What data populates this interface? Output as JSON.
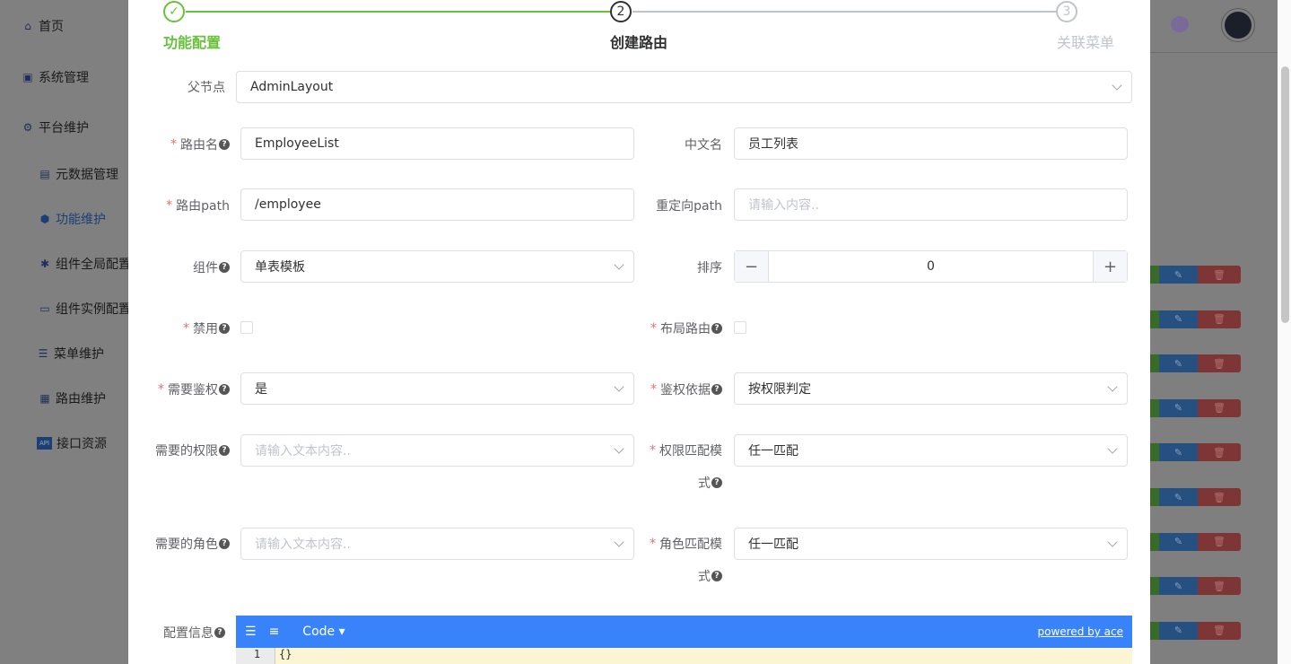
{
  "sidebar": {
    "items": [
      {
        "label": "首页",
        "icon": "home-icon"
      },
      {
        "label": "系统管理",
        "icon": "monitor-icon"
      },
      {
        "label": "平台维护",
        "icon": "gear-icon"
      },
      {
        "label": "元数据管理",
        "icon": "table-icon"
      },
      {
        "label": "功能维护",
        "icon": "cube-icon",
        "active": true
      },
      {
        "label": "组件全局配置",
        "icon": "puzzle-icon"
      },
      {
        "label": "组件实例配置",
        "icon": "window-icon"
      },
      {
        "label": "菜单维护",
        "icon": "list-icon"
      },
      {
        "label": "路由维护",
        "icon": "route-icon"
      },
      {
        "label": "接口资源",
        "icon": "api-icon"
      }
    ]
  },
  "steps": [
    {
      "num": "✓",
      "label": "功能配置",
      "status": "finished"
    },
    {
      "num": "2",
      "label": "创建路由",
      "status": "active"
    },
    {
      "num": "3",
      "label": "关联菜单",
      "status": "wait"
    }
  ],
  "form": {
    "parent": {
      "label": "父节点",
      "value": "AdminLayout"
    },
    "route_name": {
      "label": "路由名",
      "value": "EmployeeList"
    },
    "cn_name": {
      "label": "中文名",
      "value": "员工列表"
    },
    "route_path": {
      "label": "路由path",
      "value": "/employee"
    },
    "redirect": {
      "label": "重定向path",
      "placeholder": "请输入内容.."
    },
    "component": {
      "label": "组件",
      "value": "单表模板"
    },
    "sort": {
      "label": "排序",
      "value": "0",
      "minus": "−",
      "plus": "+"
    },
    "disabled": {
      "label": "禁用",
      "checked": false
    },
    "layout_route": {
      "label": "布局路由",
      "checked": false
    },
    "need_auth": {
      "label": "需要鉴权",
      "value": "是"
    },
    "auth_basis": {
      "label": "鉴权依据",
      "value": "按权限判定"
    },
    "perms": {
      "label": "需要的权限",
      "placeholder": "请输入文本内容.."
    },
    "perm_match": {
      "label1": "权限匹配模",
      "label2": "式",
      "value": "任一匹配"
    },
    "roles": {
      "label": "需要的角色",
      "placeholder": "请输入文本内容.."
    },
    "role_match": {
      "label1": "角色匹配模",
      "label2": "式",
      "value": "任一匹配"
    },
    "config": {
      "label": "配置信息",
      "mode": "Code ▾",
      "powered": "powered by ace",
      "line_no": "1",
      "code": "{}"
    }
  },
  "colors": {
    "success": "#67c23a",
    "primary": "#3883fa",
    "required": "#f56c6c"
  }
}
